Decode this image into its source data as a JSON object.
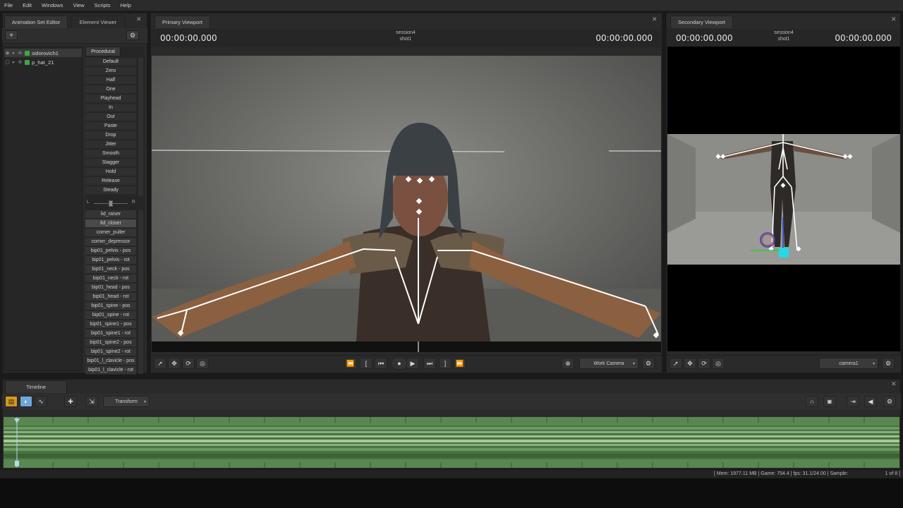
{
  "menu": [
    "File",
    "Edit",
    "Windows",
    "View",
    "Scripts",
    "Help"
  ],
  "left_panel": {
    "tabs": [
      "Animation Set Editor",
      "Element Viewer"
    ],
    "tree": [
      {
        "name": "sidorovich1",
        "selected": true
      },
      {
        "name": "p_hat_21",
        "selected": false
      }
    ],
    "procedural_tab": "Procedural",
    "presets": [
      "Default",
      "Zero",
      "Half",
      "One",
      "Playhead",
      "In",
      "Out",
      "Paste",
      "Drop",
      "Jitter",
      "Smooth",
      "Stagger",
      "Hold",
      "Release",
      "Steady"
    ],
    "balance_left": "L",
    "balance_right": "R",
    "controls": [
      "lid_raiser",
      "lid_closer",
      "corner_puller",
      "corner_depressor",
      "bip01_pelvis - pos",
      "bip01_pelvis - rot",
      "bip01_neck - pos",
      "bip01_neck - rot",
      "bip01_head - pos",
      "bip01_head - rot",
      "bip01_spine - pos",
      "bip01_spine - rot",
      "bip01_spine1 - pos",
      "bip01_spine1 - rot",
      "bip01_spine2 - pos",
      "bip01_spine2 - rot",
      "bip01_l_clavicle - pos",
      "bip01_l_clavicle - rot"
    ]
  },
  "primary": {
    "tab": "Primary Viewport",
    "timecode_left": "00:00:00.000",
    "timecode_right": "00:00:00.000",
    "session": "session4",
    "shot": "shot1",
    "camera": "Work Camera"
  },
  "secondary": {
    "tab": "Secondary Viewport",
    "timecode_left": "00:00:00.000",
    "timecode_right": "00:00:00.000",
    "session": "session4",
    "shot": "shot1",
    "camera": "camera1"
  },
  "timeline": {
    "tab": "Timeline",
    "mode": "Transform"
  },
  "status": {
    "left": "[ Mem:  1977.11 MB | Game:       754.4 | fps:     31.1/24.00 | Sample:",
    "right": "1 of 8 ]"
  },
  "colors": {
    "accent_orange": "#d49a1c",
    "accent_blue": "#6fa8d8",
    "track_green": "#486e3e"
  }
}
